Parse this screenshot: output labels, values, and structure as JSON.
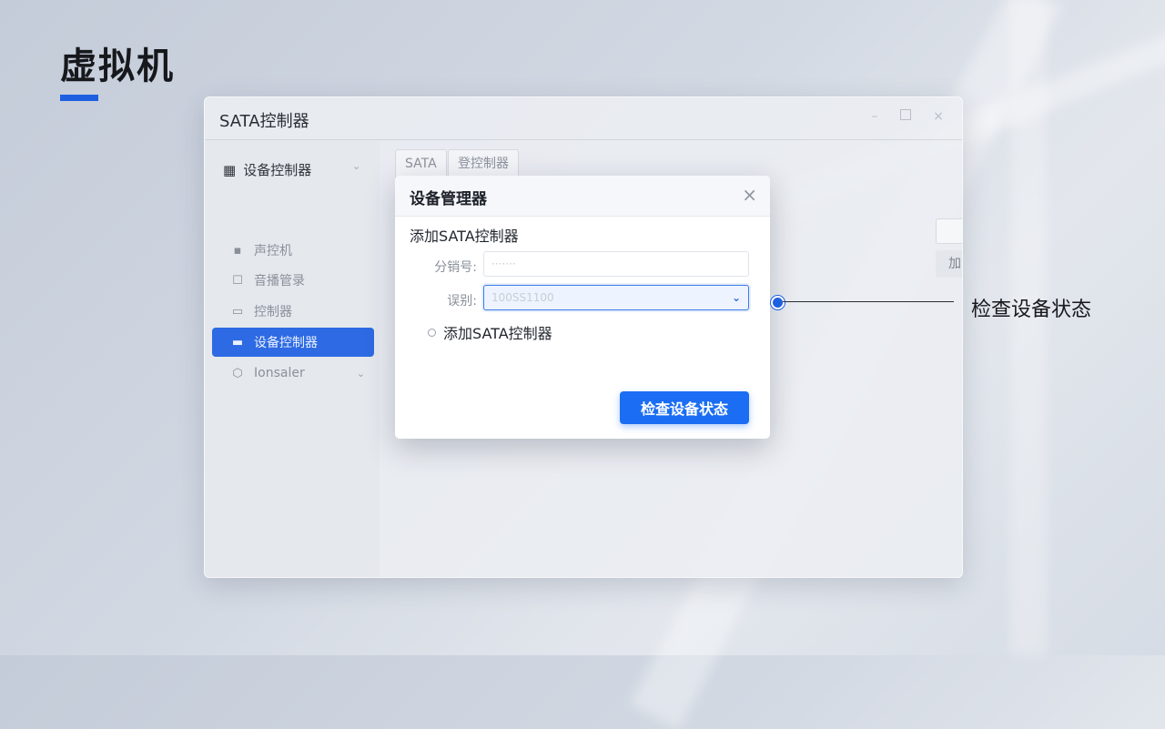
{
  "slide": {
    "title": "虚拟机",
    "accent_color": "#1d5fe0"
  },
  "window": {
    "title": "SATA控制器",
    "controls": {
      "minimize": "–",
      "close": "×"
    },
    "sidebar": {
      "group_label": "设备控制器",
      "items": [
        {
          "label": "声控机",
          "icon": "box-icon"
        },
        {
          "label": "音播管录",
          "icon": "square-icon"
        },
        {
          "label": "控制器",
          "icon": "folder-icon"
        },
        {
          "label": "设备控制器",
          "icon": "controller-icon",
          "active": true
        },
        {
          "label": "Ionsaler",
          "icon": "cube-icon"
        }
      ]
    },
    "tabs": [
      "SATA",
      "登控制器"
    ],
    "background_row_label": "加SATA控制器"
  },
  "modal": {
    "title": "设备管理器",
    "close_glyph": "×",
    "section_title": "添加SATA控制器",
    "fields": {
      "slot_label": "分销号:",
      "slot_placeholder": "·······",
      "type_label": "误别:",
      "type_value": "100SS1100"
    },
    "radio_label": "添加SATA控制器",
    "primary_button": "检查设备状态"
  },
  "callout": {
    "text": "检查设备状态"
  }
}
